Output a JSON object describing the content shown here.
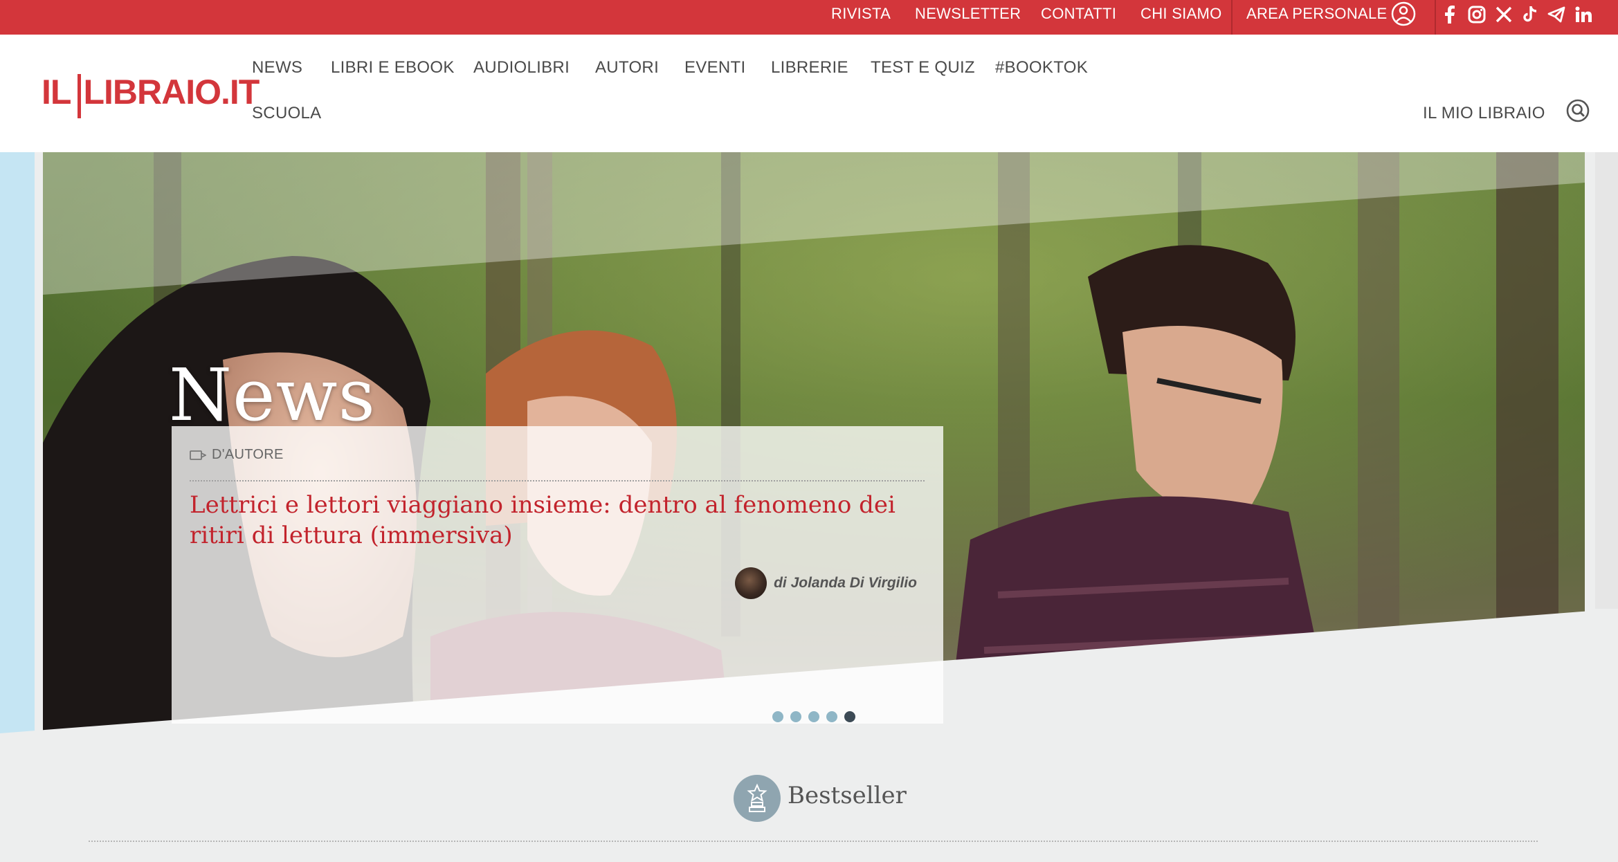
{
  "topbar": {
    "links": [
      "RIVISTA",
      "NEWSLETTER",
      "CONTATTI",
      "CHI SIAMO",
      "AREA PERSONALE"
    ],
    "social": [
      "facebook-icon",
      "instagram-icon",
      "x-icon",
      "tiktok-icon",
      "telegram-icon",
      "linkedin-icon"
    ]
  },
  "header": {
    "logo": {
      "il": "IL",
      "libraio": "LIBRAIO.IT"
    },
    "nav": [
      "NEWS",
      "LIBRI E EBOOK",
      "AUDIOLIBRI",
      "AUTORI",
      "EVENTI",
      "LIBRERIE",
      "TEST E QUIZ",
      "#BOOKTOK",
      "SCUOLA"
    ],
    "my_libraio": "IL MIO LIBRAIO"
  },
  "hero": {
    "section_title": "News",
    "card": {
      "category": "D'AUTORE",
      "headline": "Lettrici e lettori viaggiano insieme: dentro al fenomeno dei ritiri di lettura (immersiva)",
      "author": "di Jolanda Di Virgilio"
    },
    "slides_count": 5,
    "active_slide": 5
  },
  "bestseller": {
    "title": "Bestseller"
  },
  "colors": {
    "brand_red": "#d3363b",
    "headline_red": "#c2232c",
    "light_blue": "#c5e5f3",
    "section_gray": "#edeeee"
  }
}
